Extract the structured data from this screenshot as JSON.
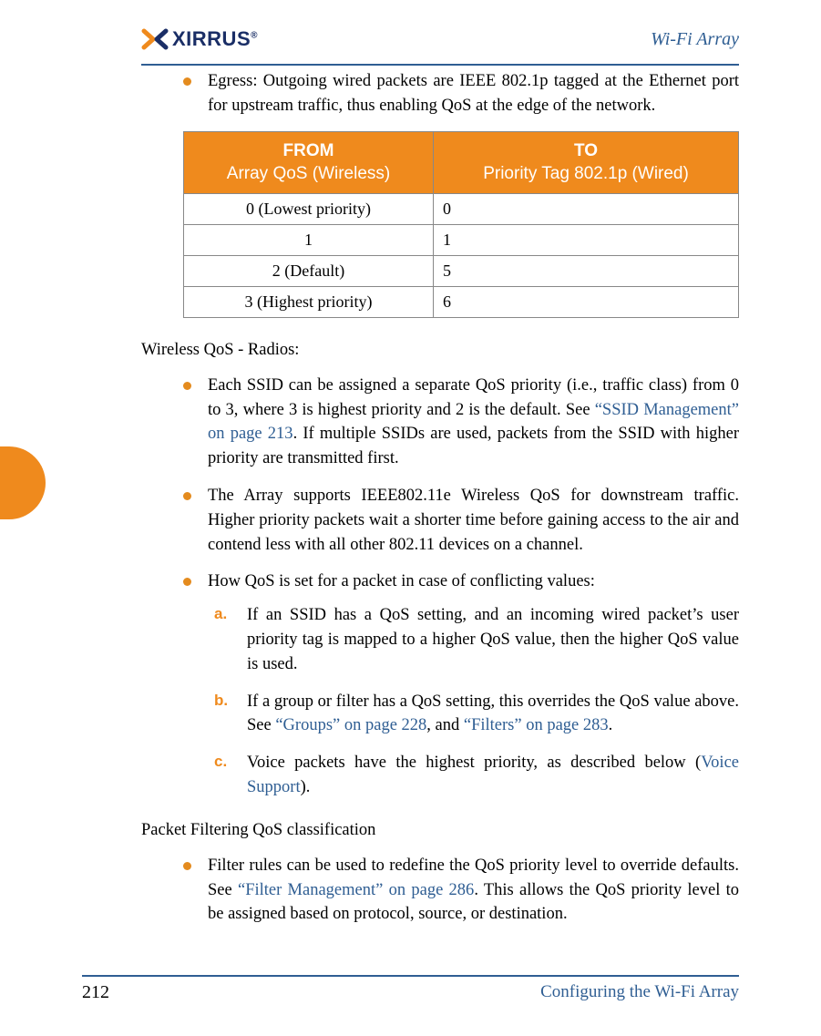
{
  "header": {
    "brand_word": "XIRRUS",
    "brand_title": "Wi-Fi Array",
    "colors": {
      "accent": "#ef8a1d",
      "brand_blue": "#2f5e93",
      "logo_navy": "#1a2e66"
    }
  },
  "footer": {
    "page_number": "212",
    "section_title": "Configuring the Wi-Fi Array"
  },
  "content": {
    "egress_bullet": "Egress: Outgoing wired packets are IEEE 802.1p tagged at the Ethernet port for upstream traffic, thus enabling QoS at the edge of the network.",
    "table": {
      "header_from_line1": "FROM",
      "header_from_line2": "Array QoS (Wireless)",
      "header_to_line1": "TO",
      "header_to_line2": "Priority Tag 802.1p (Wired)",
      "rows": [
        {
          "from": "0 (Lowest priority)",
          "to": "0"
        },
        {
          "from": "1",
          "to": "1"
        },
        {
          "from": "2 (Default)",
          "to": "5"
        },
        {
          "from": "3 (Highest priority)",
          "to": "6"
        }
      ]
    },
    "heading_radios": "Wireless QoS - Radios:",
    "radio_bullets": {
      "b1_pre": "Each SSID can be assigned a separate QoS priority (i.e., traffic class) from 0 to 3, where 3 is highest priority and 2 is the default. See ",
      "b1_link": "“SSID Management” on page 213",
      "b1_post": ". If multiple SSIDs are used, packets from the SSID with higher priority are transmitted first.",
      "b2": "The Array supports IEEE802.11e Wireless QoS for downstream traffic. Higher priority packets wait a shorter time before gaining access to the air and contend less with all other 802.11 devices on a channel.",
      "b3": "How QoS is set for a packet in case of conflicting values:"
    },
    "sublist": {
      "a_label": "a.",
      "a_text": "If an SSID has a QoS setting, and an incoming wired packet’s user priority tag is mapped to a higher QoS value, then the higher QoS value is used.",
      "b_label": "b.",
      "b_pre": "If a group or filter has a QoS setting, this overrides the QoS value above. See ",
      "b_link1": "“Groups” on page 228",
      "b_mid": ", and ",
      "b_link2": "“Filters” on page 283",
      "b_post": ".",
      "c_label": "c.",
      "c_pre": "Voice packets have the highest priority, as described below (",
      "c_link": "Voice Support",
      "c_post": ")."
    },
    "heading_filtering": "Packet Filtering QoS classification",
    "filtering_bullet": {
      "pre": "Filter rules can be used to redefine the QoS priority level to override defaults. See ",
      "link": "“Filter Management” on page 286",
      "post": ". This allows the QoS priority level to be assigned based on protocol, source, or destination."
    }
  }
}
